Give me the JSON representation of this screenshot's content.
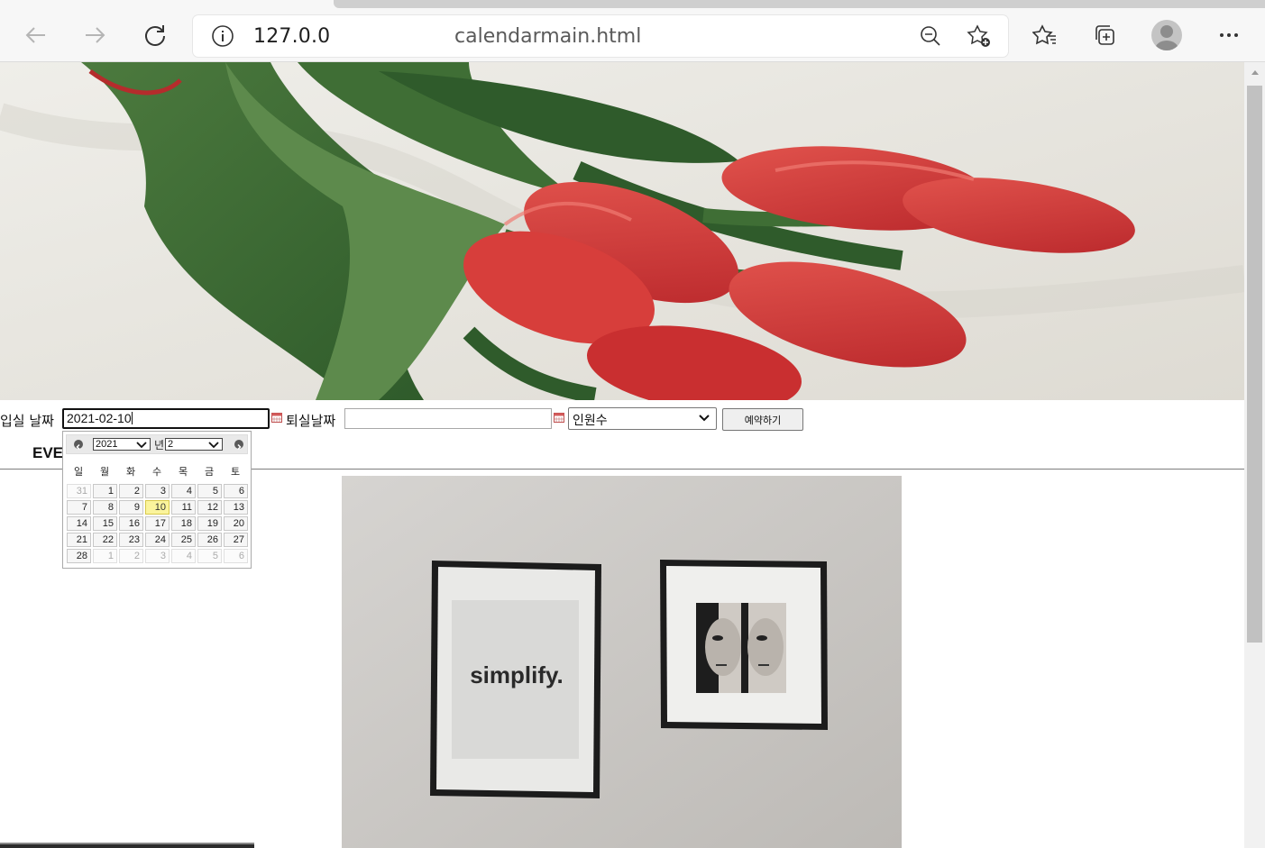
{
  "browser": {
    "url_visible_start": "127.0.0.",
    "url_visible_end": "calendarmain.html",
    "colors": {
      "chrome_bg": "#f7f7f7",
      "icon": "#3c3c3c"
    },
    "icons": [
      "back-icon",
      "forward-icon",
      "reload-icon",
      "info-icon",
      "zoom-out-icon",
      "add-favorite-icon",
      "favorites-icon",
      "collections-icon",
      "profile-icon",
      "more-icon"
    ]
  },
  "form": {
    "checkin_label": "입실 날짜",
    "checkin_value": "2021-02-10",
    "checkout_label": "퇴실날짜",
    "checkout_value": "",
    "people_selected": "인원수",
    "reserve_button": "예약하기"
  },
  "event_title_visible": "EVE",
  "datepicker": {
    "year": "2021",
    "year_suffix": "년",
    "month": "2",
    "weekdays": [
      "일",
      "월",
      "화",
      "수",
      "목",
      "금",
      "토"
    ],
    "weeks": [
      [
        {
          "d": "31",
          "o": true
        },
        {
          "d": "1"
        },
        {
          "d": "2"
        },
        {
          "d": "3"
        },
        {
          "d": "4"
        },
        {
          "d": "5"
        },
        {
          "d": "6"
        }
      ],
      [
        {
          "d": "7"
        },
        {
          "d": "8"
        },
        {
          "d": "9"
        },
        {
          "d": "10",
          "today": true
        },
        {
          "d": "11"
        },
        {
          "d": "12"
        },
        {
          "d": "13"
        }
      ],
      [
        {
          "d": "14"
        },
        {
          "d": "15"
        },
        {
          "d": "16"
        },
        {
          "d": "17"
        },
        {
          "d": "18"
        },
        {
          "d": "19"
        },
        {
          "d": "20"
        }
      ],
      [
        {
          "d": "21"
        },
        {
          "d": "22"
        },
        {
          "d": "23"
        },
        {
          "d": "24"
        },
        {
          "d": "25"
        },
        {
          "d": "26"
        },
        {
          "d": "27"
        }
      ],
      [
        {
          "d": "28"
        },
        {
          "d": "1",
          "o": true
        },
        {
          "d": "2",
          "o": true
        },
        {
          "d": "3",
          "o": true
        },
        {
          "d": "4",
          "o": true
        },
        {
          "d": "5",
          "o": true
        },
        {
          "d": "6",
          "o": true
        }
      ]
    ],
    "colors": {
      "today": "#fbf49c",
      "header": "#e9e9e9"
    }
  },
  "gallery": {
    "poster_text": "simplify."
  }
}
